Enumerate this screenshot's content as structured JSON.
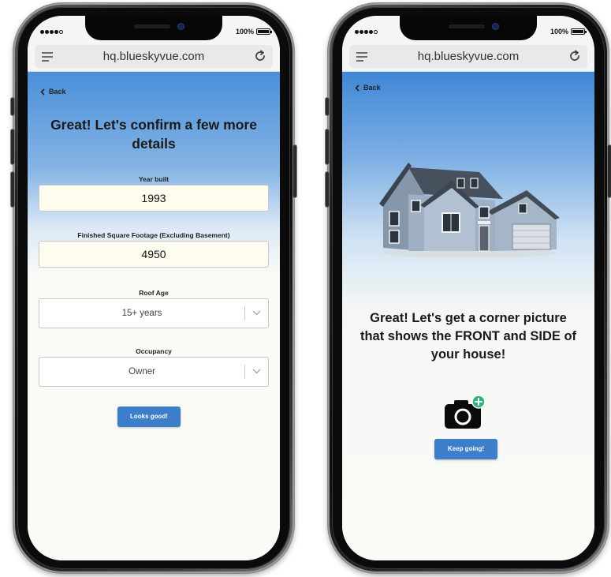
{
  "browser": {
    "url": "hq.blueskyvue.com",
    "battery_text": "100%"
  },
  "left_screen": {
    "back_label": "Back",
    "title_line1": "Great! Let's confirm a few more",
    "title_line2": "details",
    "fields": [
      {
        "label": "Year built",
        "value": "1993"
      },
      {
        "label": "Finished Square Footage (Excluding Basement)",
        "value": "4950"
      }
    ],
    "selects": [
      {
        "label": "Roof Age",
        "value": "15+ years"
      },
      {
        "label": "Occupancy",
        "value": "Owner"
      }
    ],
    "submit_label": "Looks good!"
  },
  "right_screen": {
    "back_label": "Back",
    "message_line1": "Great! Let's get a corner picture",
    "message_line2": "that shows the FRONT and SIDE of",
    "message_line3": "your house!",
    "continue_label": "Keep going!"
  },
  "colors": {
    "header_gradient_top": "#4a8fd8",
    "button_blue": "#3c7ec9",
    "input_bg": "#fffdf0",
    "camera_badge": "#2fb37a"
  },
  "icons": [
    "menu-icon",
    "reload-icon",
    "back-chevron-icon",
    "chevron-down-icon",
    "camera-add-icon",
    "house-image"
  ]
}
